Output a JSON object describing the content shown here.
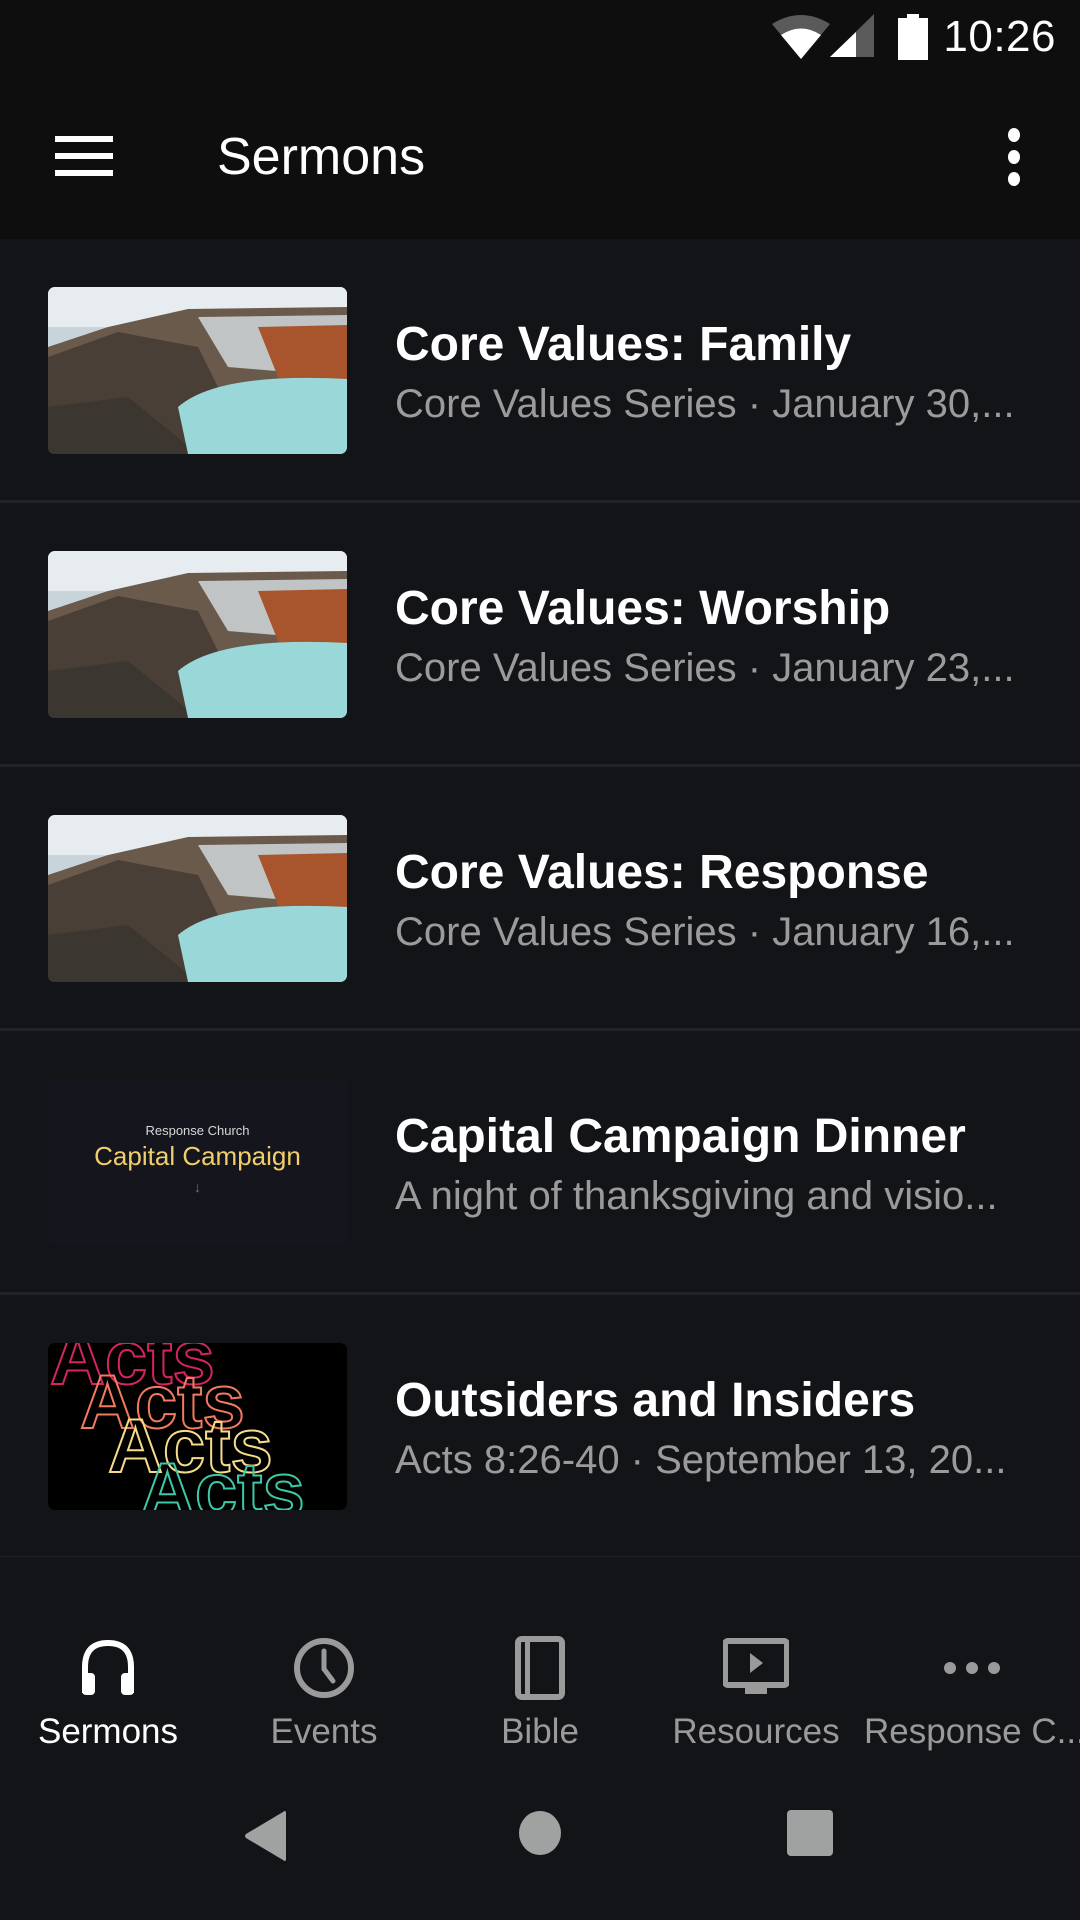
{
  "status_bar": {
    "time": "10:26",
    "icons": [
      "wifi-icon",
      "cell-signal-icon",
      "battery-icon"
    ]
  },
  "app_bar": {
    "title": "Sermons",
    "menu_icon": "hamburger-menu-icon",
    "overflow_icon": "more-vert-icon"
  },
  "sermons": [
    {
      "title": "Core Values: Family",
      "subtitle": "Core Values Series · January 30,...",
      "thumbnail": "crater-lake-landscape"
    },
    {
      "title": "Core Values: Worship",
      "subtitle": "Core Values Series · January 23,...",
      "thumbnail": "crater-lake-landscape"
    },
    {
      "title": "Core Values: Response",
      "subtitle": "Core Values Series · January 16,...",
      "thumbnail": "crater-lake-landscape"
    },
    {
      "title": "Capital Campaign Dinner",
      "subtitle": "A night of thanksgiving and visio...",
      "thumbnail": "capital-campaign-graphic",
      "thumb_text": {
        "small": "Response Church",
        "large": "Capital Campaign",
        "arrow": "↓"
      }
    },
    {
      "title": "Outsiders and Insiders",
      "subtitle": "Acts 8:26-40 · September 13, 20...",
      "thumbnail": "acts-series-graphic",
      "thumb_text": {
        "word": "Acts"
      }
    }
  ],
  "bottom_nav": {
    "items": [
      {
        "label": "Sermons",
        "icon": "headphones-icon",
        "active": true
      },
      {
        "label": "Events",
        "icon": "clock-icon",
        "active": false
      },
      {
        "label": "Bible",
        "icon": "book-icon",
        "active": false
      },
      {
        "label": "Resources",
        "icon": "tv-play-icon",
        "active": false
      },
      {
        "label": "Response C...",
        "icon": "more-horiz-icon",
        "active": false
      }
    ]
  },
  "system_nav": {
    "buttons": [
      "back",
      "home",
      "recents"
    ]
  },
  "colors": {
    "background": "#131417",
    "bar_background": "#0e0e0f",
    "divider": "#222326",
    "text_primary": "#ffffff",
    "text_secondary": "#9b9b9b",
    "campaign_gold": "#f0cf6a",
    "acts_colors": [
      "#d8245e",
      "#f27a5e",
      "#f6dc8a",
      "#3cc9a8"
    ]
  }
}
